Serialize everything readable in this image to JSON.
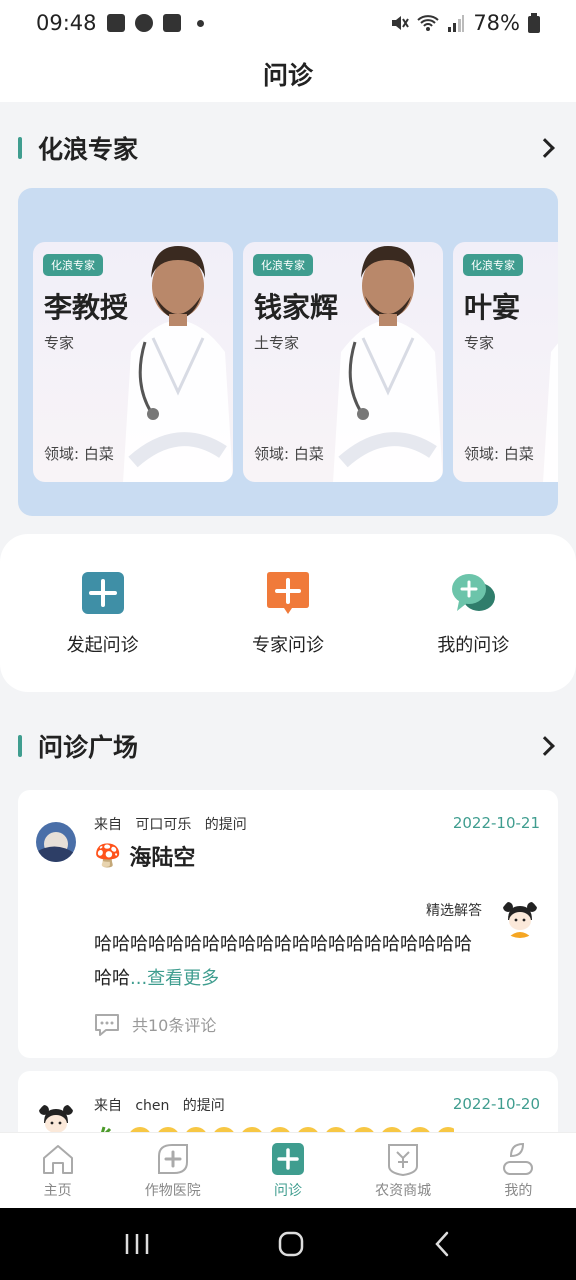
{
  "status_bar": {
    "time": "09:48",
    "battery": "78%"
  },
  "header": {
    "title": "问诊"
  },
  "experts_section": {
    "title": "化浪专家",
    "cards": [
      {
        "badge": "化浪专家",
        "name": "李教授",
        "role": "专家",
        "field": "领域: 白菜"
      },
      {
        "badge": "化浪专家",
        "name": "钱家辉",
        "role": "土专家",
        "field": "领域: 白菜"
      },
      {
        "badge": "化浪专家",
        "name": "叶宴",
        "role": "专家",
        "field": "领域: 白菜"
      }
    ]
  },
  "actions": [
    {
      "label": "发起问诊",
      "icon": "plus-square-icon",
      "color": "#3f8fa6"
    },
    {
      "label": "专家问诊",
      "icon": "plus-chat-icon",
      "color": "#f07a3a"
    },
    {
      "label": "我的问诊",
      "icon": "chat-bubbles-icon",
      "color": "#5fb8a0"
    }
  ],
  "plaza_section": {
    "title": "问诊广场"
  },
  "posts": [
    {
      "from_prefix": "来自",
      "user": "可口可乐",
      "from_suffix": "的提问",
      "date": "2022-10-21",
      "emoji": "🍄",
      "title": "海陆空",
      "answer_label": "精选解答",
      "answer": "哈哈哈哈哈哈哈哈哈哈哈哈哈哈哈哈哈哈哈哈哈哈哈",
      "more": "...查看更多",
      "comments": "共10条评论"
    },
    {
      "from_prefix": "来自",
      "user": "chen",
      "from_suffix": "的提问",
      "date": "2022-10-20"
    }
  ],
  "bottom_nav": [
    {
      "label": "主页",
      "icon": "home-icon",
      "active": false
    },
    {
      "label": "作物医院",
      "icon": "leaf-plus-icon",
      "active": false
    },
    {
      "label": "问诊",
      "icon": "plus-square-icon",
      "active": true
    },
    {
      "label": "农资商城",
      "icon": "bag-icon",
      "active": false
    },
    {
      "label": "我的",
      "icon": "user-icon",
      "active": false
    }
  ],
  "colors": {
    "accent": "#3f9d8f",
    "orange": "#f07a3a",
    "panel_blue": "#c9dcf2"
  }
}
